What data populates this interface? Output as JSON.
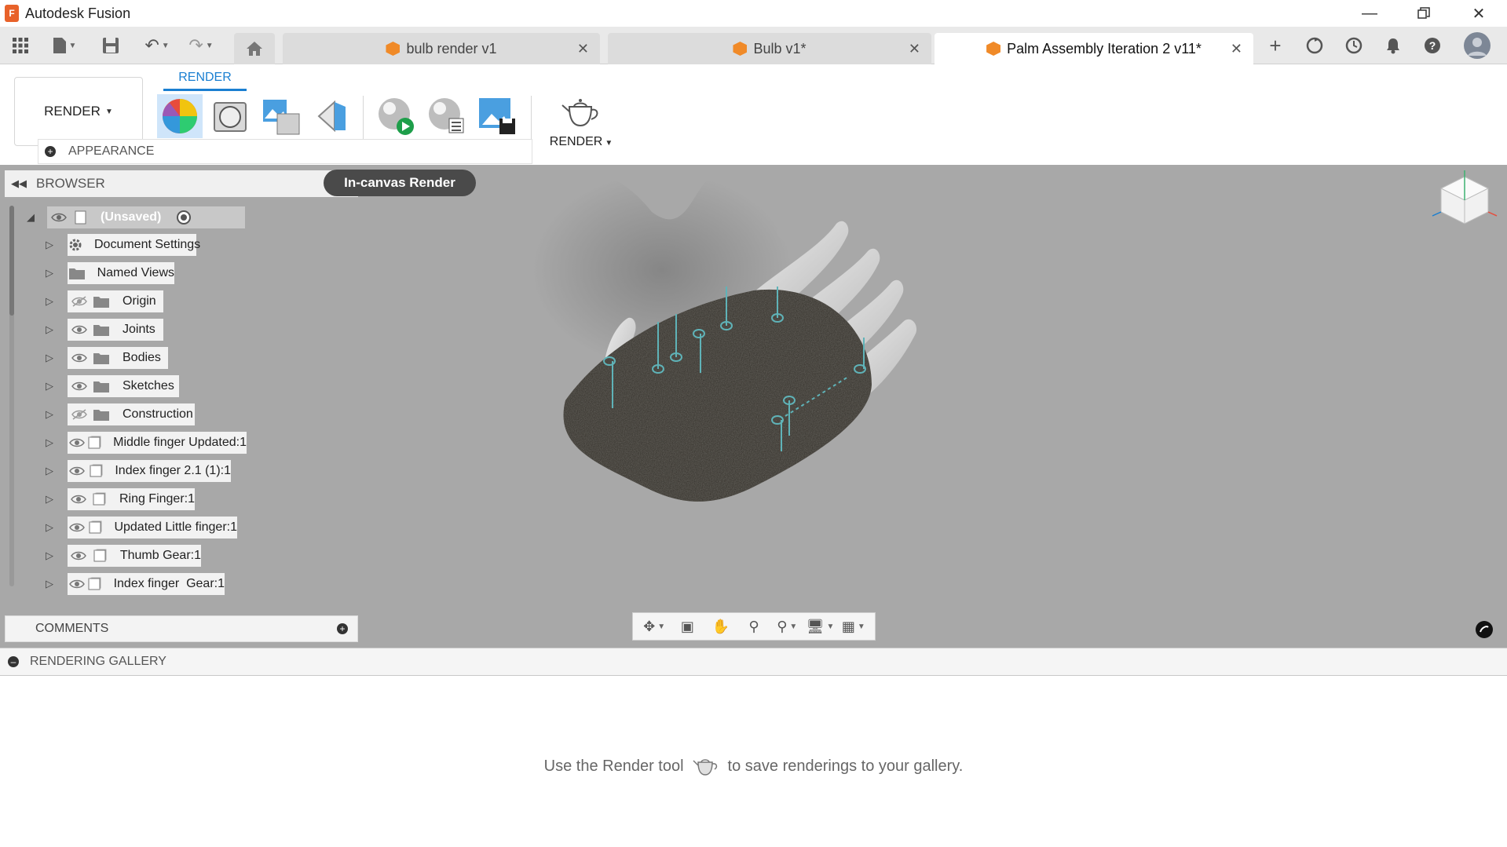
{
  "app": {
    "title": "Autodesk Fusion",
    "logo_letter": "F"
  },
  "tabs": [
    {
      "label": "bulb render v1",
      "active": false
    },
    {
      "label": "Bulb v1*",
      "active": false
    },
    {
      "label": "Palm Assembly Iteration 2 v11*",
      "active": true
    }
  ],
  "ribbon": {
    "workspace_tab": "RENDER",
    "workspace_switch": "RENDER",
    "appearance_panel": "APPEARANCE",
    "render_group_label": "RENDER",
    "tools": [
      "appearance-icon",
      "scene-settings-icon",
      "texture-map-icon",
      "decal-icon",
      "in-canvas-render-icon",
      "in-canvas-settings-icon",
      "capture-image-icon",
      "render-teapot-icon"
    ]
  },
  "tooltip": "In-canvas Render",
  "browser": {
    "title": "BROWSER",
    "root": "(Unsaved)",
    "items": [
      {
        "label": "Document Settings",
        "icon": "gear-icon",
        "eye": "none"
      },
      {
        "label": "Named Views",
        "icon": "folder-icon",
        "eye": "none"
      },
      {
        "label": "Origin",
        "icon": "folder-icon",
        "eye": "hidden"
      },
      {
        "label": "Joints",
        "icon": "folder-icon",
        "eye": "visible"
      },
      {
        "label": "Bodies",
        "icon": "folder-icon",
        "eye": "visible"
      },
      {
        "label": "Sketches",
        "icon": "folder-icon",
        "eye": "visible"
      },
      {
        "label": "Construction",
        "icon": "folder-icon",
        "eye": "hidden"
      },
      {
        "label": "Middle finger Updated:1",
        "icon": "component-icon",
        "eye": "visible"
      },
      {
        "label": "Index finger 2.1 (1):1",
        "icon": "component-icon",
        "eye": "visible"
      },
      {
        "label": "Ring Finger:1",
        "icon": "component-icon",
        "eye": "visible"
      },
      {
        "label": "Updated Little finger:1",
        "icon": "component-icon",
        "eye": "visible"
      },
      {
        "label": "Thumb Gear:1",
        "icon": "component-icon",
        "eye": "visible"
      },
      {
        "label": "Index finger  Gear:1",
        "icon": "component-icon",
        "eye": "visible"
      }
    ]
  },
  "comments": {
    "title": "COMMENTS"
  },
  "gallery": {
    "title": "RENDERING GALLERY",
    "message_before": "Use the Render tool",
    "message_after": "to save renderings to your gallery."
  },
  "colors": {
    "accent": "#1a7fd1",
    "viewport_bg": "#a8a8a8",
    "tab_cube": "#f08a28",
    "model_surface": "#3e3b35",
    "fingers": "#d7d7d7",
    "joints": "#5fb3b8"
  }
}
